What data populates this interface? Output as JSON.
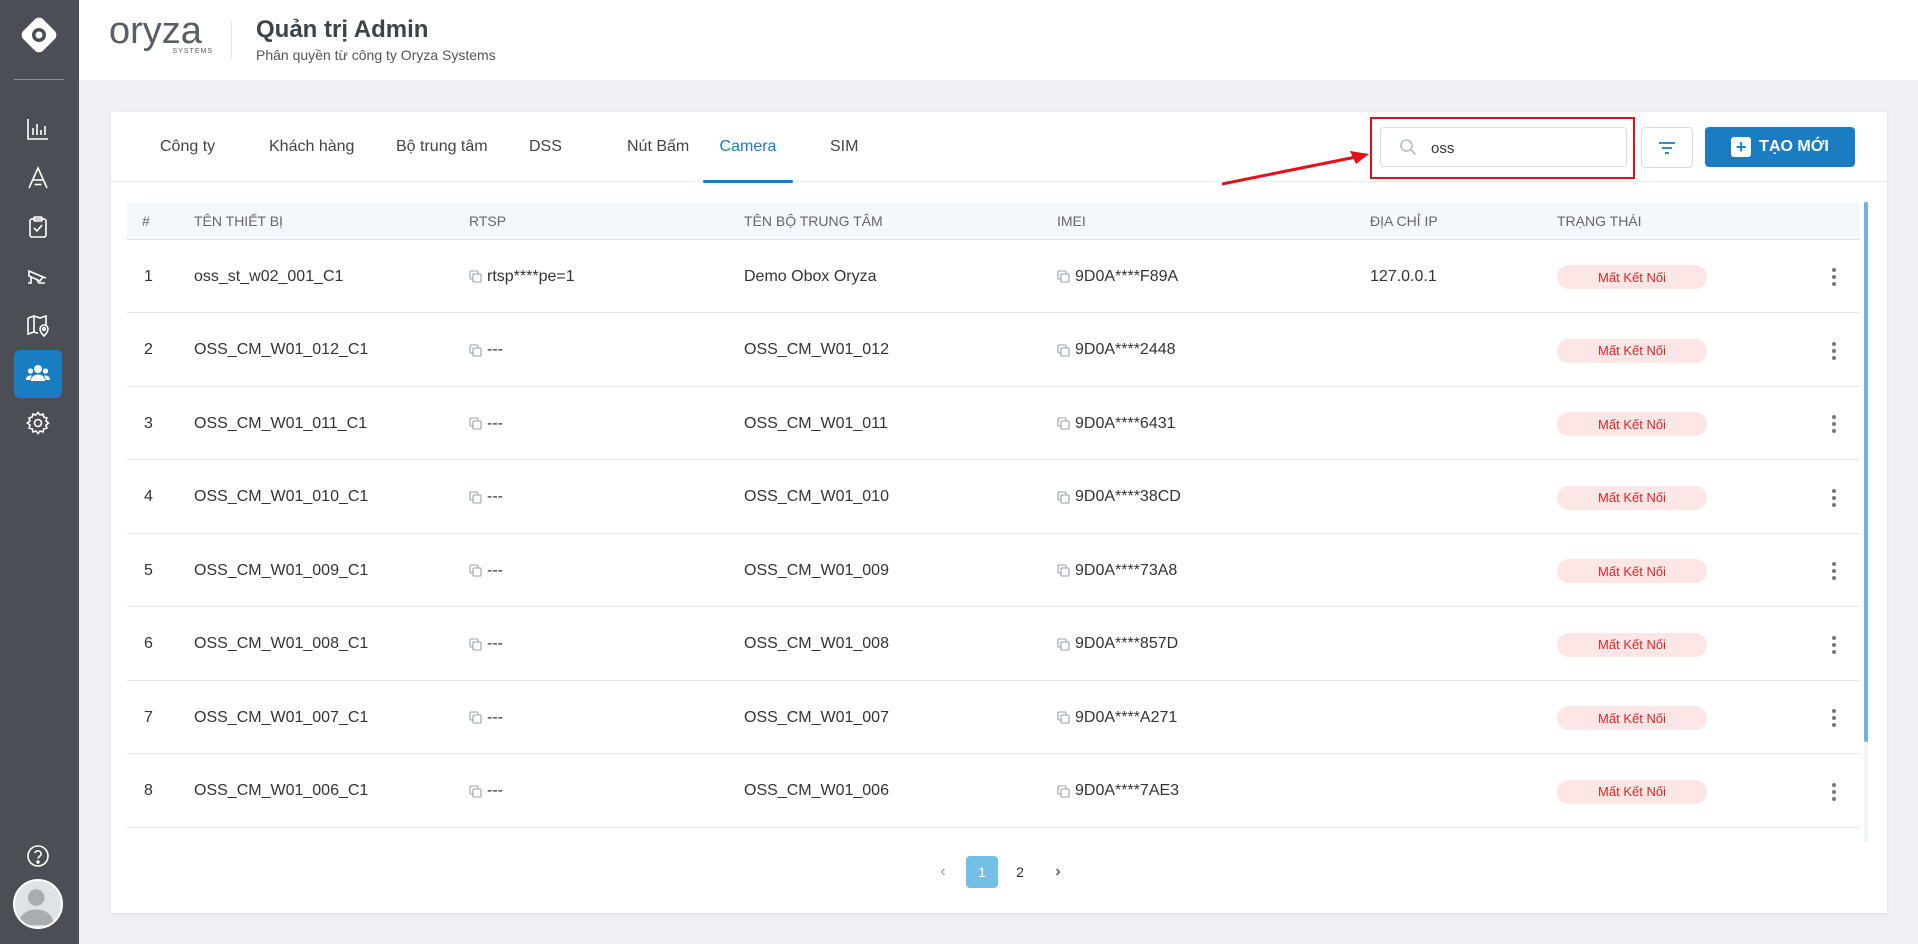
{
  "header": {
    "brand": "oryza",
    "brand_sub": "SYSTEMS",
    "title": "Quản trị Admin",
    "subtitle": "Phân quyền từ công ty Oryza Systems"
  },
  "sidebar": {
    "items": [
      {
        "icon": "chart-icon",
        "active": false
      },
      {
        "icon": "letter-a-icon",
        "active": false
      },
      {
        "icon": "clipboard-check-icon",
        "active": false
      },
      {
        "icon": "cctv-icon",
        "active": false
      },
      {
        "icon": "map-pin-icon",
        "active": false
      },
      {
        "icon": "users-icon",
        "active": true
      },
      {
        "icon": "gear-icon",
        "active": false
      }
    ],
    "help_icon": "question-icon",
    "avatar_icon": "user-avatar-icon"
  },
  "tabs": [
    {
      "label": "Công ty"
    },
    {
      "label": "Khách hàng"
    },
    {
      "label": "Bộ trung tâm"
    },
    {
      "label": "DSS"
    },
    {
      "label": "Nút Bấm"
    },
    {
      "label": "Camera"
    },
    {
      "label": "SIM"
    }
  ],
  "active_tab": "Camera",
  "search": {
    "value": "oss",
    "placeholder": ""
  },
  "create_button": {
    "label": "TẠO MỚI"
  },
  "table": {
    "columns": [
      "#",
      "TÊN THIẾT BỊ",
      "RTSP",
      "TÊN BỘ TRUNG TÂM",
      "IMEI",
      "ĐỊA CHỈ IP",
      "TRẠNG THÁI"
    ],
    "rows": [
      {
        "index": "1",
        "name": "oss_st_w02_001_C1",
        "rtsp": "rtsp****pe=1",
        "center": "Demo Obox Oryza",
        "imei": "9D0A****F89A",
        "ip": "127.0.0.1",
        "status": "Mất Kết Nối"
      },
      {
        "index": "2",
        "name": "OSS_CM_W01_012_C1",
        "rtsp": "---",
        "center": "OSS_CM_W01_012",
        "imei": "9D0A****2448",
        "ip": "",
        "status": "Mất Kết Nối"
      },
      {
        "index": "3",
        "name": "OSS_CM_W01_011_C1",
        "rtsp": "---",
        "center": "OSS_CM_W01_011",
        "imei": "9D0A****6431",
        "ip": "",
        "status": "Mất Kết Nối"
      },
      {
        "index": "4",
        "name": "OSS_CM_W01_010_C1",
        "rtsp": "---",
        "center": "OSS_CM_W01_010",
        "imei": "9D0A****38CD",
        "ip": "",
        "status": "Mất Kết Nối"
      },
      {
        "index": "5",
        "name": "OSS_CM_W01_009_C1",
        "rtsp": "---",
        "center": "OSS_CM_W01_009",
        "imei": "9D0A****73A8",
        "ip": "",
        "status": "Mất Kết Nối"
      },
      {
        "index": "6",
        "name": "OSS_CM_W01_008_C1",
        "rtsp": "---",
        "center": "OSS_CM_W01_008",
        "imei": "9D0A****857D",
        "ip": "",
        "status": "Mất Kết Nối"
      },
      {
        "index": "7",
        "name": "OSS_CM_W01_007_C1",
        "rtsp": "---",
        "center": "OSS_CM_W01_007",
        "imei": "9D0A****A271",
        "ip": "",
        "status": "Mất Kết Nối"
      },
      {
        "index": "8",
        "name": "OSS_CM_W01_006_C1",
        "rtsp": "---",
        "center": "OSS_CM_W01_006",
        "imei": "9D0A****7AE3",
        "ip": "",
        "status": "Mất Kết Nối"
      }
    ]
  },
  "pagination": {
    "pages": [
      "1",
      "2"
    ],
    "current": "1"
  },
  "colors": {
    "accent": "#1a7cc1",
    "sidebar": "#4b4f55",
    "status_bg": "#fde6e6",
    "status_text": "#e02424",
    "highlight": "#e3101a"
  }
}
